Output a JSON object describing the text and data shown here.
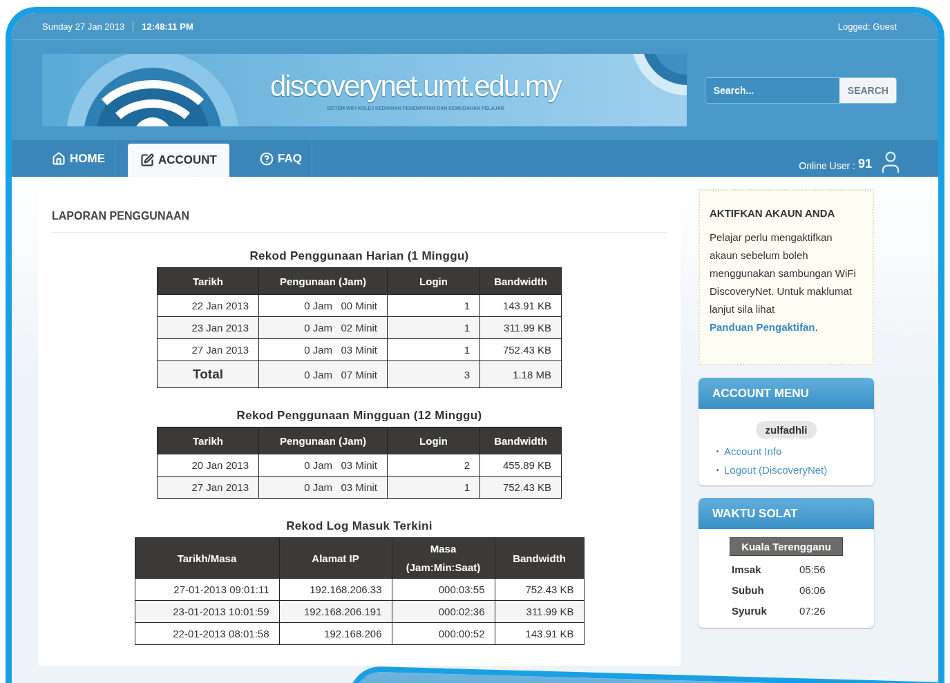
{
  "top_bar": {
    "date": "Sunday 27 Jan 2013",
    "time": "12:48:11 PM",
    "logged": "Logged: Guest"
  },
  "header": {
    "site_title": "discoverynet.umt.edu.my",
    "tagline": "SISTEM WIFI KOLEJ KEDIAMAN PENEMPATAN DAN KEMUDAHAN PELAJAR",
    "search": {
      "placeholder": "Search...",
      "button": "SEARCH"
    }
  },
  "nav": {
    "tabs": [
      {
        "label": "HOME",
        "kind": "home",
        "selected": false
      },
      {
        "label": "ACCOUNT",
        "kind": "edit",
        "selected": true
      },
      {
        "label": "FAQ",
        "kind": "help",
        "selected": false
      }
    ],
    "online_label": "Online User :",
    "online_count": "91"
  },
  "main": {
    "title": "LAPORAN PENGGUNAAN",
    "tables": [
      {
        "title": "Rekod Penggunaan Harian (1 Minggu)",
        "columns": [
          "Tarikh",
          "Pengunaan (Jam)",
          "Login",
          "Bandwidth"
        ],
        "rows": [
          {
            "kind": "data",
            "cells": [
              "22 Jan 2013",
              "0 Jam   00 Minit",
              "1",
              "143.91 KB"
            ]
          },
          {
            "kind": "data",
            "cells": [
              "23 Jan 2013",
              "0 Jam   02 Minit",
              "1",
              "311.99 KB"
            ]
          },
          {
            "kind": "data",
            "cells": [
              "27 Jan 2013",
              "0 Jam   03 Minit",
              "1",
              "752.43 KB"
            ]
          },
          {
            "kind": "total",
            "cells": [
              "Total",
              "0 Jam   07 Minit",
              "3",
              "1.18 MB"
            ]
          }
        ]
      },
      {
        "title": "Rekod Penggunaan Mingguan (12 Minggu)",
        "columns": [
          "Tarikh",
          "Pengunaan (Jam)",
          "Login",
          "Bandwidth"
        ],
        "rows": [
          {
            "kind": "data",
            "cells": [
              "20 Jan 2013",
              "0 Jam   03 Minit",
              "2",
              "455.89 KB"
            ]
          },
          {
            "kind": "data",
            "cells": [
              "27 Jan 2013",
              "0 Jam   03 Minit",
              "1",
              "752.43 KB"
            ]
          }
        ]
      },
      {
        "title": "Rekod Log Masuk Terkini",
        "columns": [
          "Tarikh/Masa",
          "Alamat IP",
          "Masa (Jam:Min:Saat)",
          "Bandwidth"
        ],
        "rows": [
          {
            "kind": "data",
            "cells": [
              "27-01-2013 09:01:11",
              "192.168.206.33",
              "000:03:55",
              "752.43 KB"
            ]
          },
          {
            "kind": "data",
            "cells": [
              "23-01-2013 10:01:59",
              "192.168.206.191",
              "000:02:36",
              "311.99 KB"
            ]
          },
          {
            "kind": "data",
            "cells": [
              "22-01-2013 08:01:58",
              "192.168.206",
              "000:00:52",
              "143.91 KB"
            ]
          }
        ]
      }
    ]
  },
  "sidebar": {
    "notice": {
      "title": "AKTIFKAN AKAUN ANDA",
      "text": "Pelajar perlu mengaktifkan akaun sebelum boleh menggunakan sambungan WiFi DiscoveryNet. Untuk maklumat lanjut sila lihat",
      "link": "Panduan Pengaktifan",
      "after": "."
    },
    "account_menu": {
      "title": "ACCOUNT MENU",
      "username": "zulfadhli",
      "links": [
        "Account Info",
        "Logout (DiscoveryNet)"
      ]
    },
    "prayer": {
      "title": "WAKTU SOLAT",
      "location": "Kuala Terengganu",
      "times": [
        {
          "name": "Imsak",
          "time": "05:56"
        },
        {
          "name": "Subuh",
          "time": "06:06"
        },
        {
          "name": "Syuruk",
          "time": "07:26"
        }
      ]
    }
  }
}
